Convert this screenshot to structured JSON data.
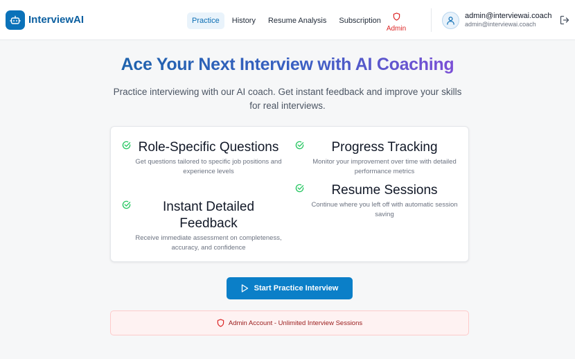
{
  "app": {
    "title": "InterviewAI",
    "logo_icon": "robot-icon"
  },
  "nav": {
    "items": [
      {
        "label": "Practice",
        "active": true
      },
      {
        "label": "History",
        "active": false
      },
      {
        "label": "Resume Analysis",
        "active": false
      },
      {
        "label": "Subscription",
        "active": false
      }
    ],
    "admin_label": "Admin"
  },
  "user": {
    "name": "admin@interviewai.coach",
    "email": "admin@interviewai.coach"
  },
  "hero": {
    "title": "Ace Your Next Interview with AI Coaching",
    "subtitle": "Practice interviewing with our AI coach. Get instant feedback and improve your skills for real interviews."
  },
  "features": [
    {
      "title": "Role-Specific Questions",
      "description": "Get questions tailored to specific job positions and experience levels"
    },
    {
      "title": "Instant Detailed Feedback",
      "description": "Receive immediate assessment on completeness, accuracy, and confidence"
    },
    {
      "title": "Progress Tracking",
      "description": "Monitor your improvement over time with detailed performance metrics"
    },
    {
      "title": "Resume Sessions",
      "description": "Continue where you left off with automatic session saving"
    }
  ],
  "cta": {
    "label": "Start Practice Interview"
  },
  "banner": {
    "text": "Admin Account - Unlimited Interview Sessions"
  },
  "colors": {
    "primary": "#0b7fc8",
    "admin_red": "#dc2626",
    "check_green": "#22c55e",
    "banner_bg": "#fef2f2"
  }
}
